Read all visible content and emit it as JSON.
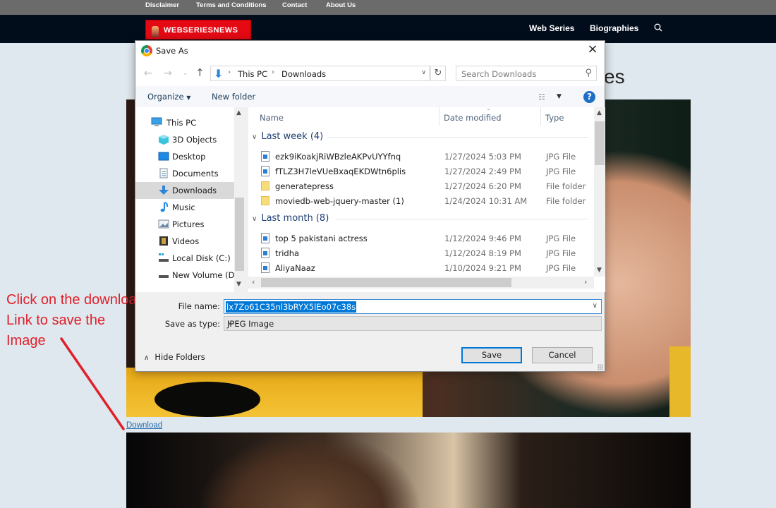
{
  "website": {
    "top_links": [
      "Disclaimer",
      "Terms and Conditions",
      "Contact",
      "About Us"
    ],
    "logo_text": "WEBSERIESNEWS",
    "nav_links": [
      "Web Series",
      "Biographies"
    ],
    "search_icon": "search-icon",
    "page_title_fragment": "es",
    "download_link": "Download",
    "colors": {
      "brand": "#e50914",
      "nav_bg": "#020d1c",
      "topbar_bg": "#6b6b6b",
      "page_bg": "#dfe8ee",
      "link": "#2c6fb0"
    }
  },
  "annotation": {
    "lines": [
      "Click on the download",
      "Link to save the",
      "Image"
    ],
    "color": "#e0202a"
  },
  "dialog": {
    "title": "Save As",
    "close_icon": "close-icon",
    "address": {
      "crumbs": [
        "This PC",
        "Downloads"
      ]
    },
    "search_placeholder": "Search Downloads",
    "toolbar": {
      "organize": "Organize",
      "new_folder": "New folder",
      "help": "?"
    },
    "nav_pane": [
      {
        "label": "This PC",
        "icon": "computer-icon"
      },
      {
        "label": "3D Objects",
        "icon": "cube-icon"
      },
      {
        "label": "Desktop",
        "icon": "desktop-icon"
      },
      {
        "label": "Documents",
        "icon": "document-icon"
      },
      {
        "label": "Downloads",
        "icon": "download-icon",
        "selected": true
      },
      {
        "label": "Music",
        "icon": "music-note-icon"
      },
      {
        "label": "Pictures",
        "icon": "picture-icon"
      },
      {
        "label": "Videos",
        "icon": "film-icon"
      },
      {
        "label": "Local Disk (C:)",
        "icon": "drive-icon"
      },
      {
        "label": "New Volume (D:)",
        "icon": "drive-icon"
      }
    ],
    "columns": [
      "Name",
      "Date modified",
      "Type"
    ],
    "groups": [
      {
        "label": "Last week (4)",
        "files": [
          {
            "name": "ezk9iKoakjRiWBzleAKPvUYYfnq",
            "date": "1/27/2024 5:03 PM",
            "type": "JPG File",
            "kind": "jpg"
          },
          {
            "name": "fTLZ3H7leVUeBxaqEKDWtn6plis",
            "date": "1/27/2024 2:49 PM",
            "type": "JPG File",
            "kind": "jpg"
          },
          {
            "name": "generatepress",
            "date": "1/27/2024 6:20 PM",
            "type": "File folder",
            "kind": "folder"
          },
          {
            "name": "moviedb-web-jquery-master (1)",
            "date": "1/24/2024 10:31 AM",
            "type": "File folder",
            "kind": "folder"
          }
        ]
      },
      {
        "label": "Last month (8)",
        "files": [
          {
            "name": "top 5 pakistani actress",
            "date": "1/12/2024 9:46 PM",
            "type": "JPG File",
            "kind": "jpg"
          },
          {
            "name": "tridha",
            "date": "1/12/2024 8:19 PM",
            "type": "JPG File",
            "kind": "jpg"
          },
          {
            "name": "AliyaNaaz",
            "date": "1/10/2024 9:21 PM",
            "type": "JPG File",
            "kind": "jpg"
          }
        ]
      }
    ],
    "file_name_label": "File name:",
    "file_name_value": "lx7Zo61C35nl3bRYX5lEo07c38s",
    "save_as_type_label": "Save as type:",
    "save_as_type_value": "JPEG Image",
    "hide_folders": "Hide Folders",
    "save_button": "Save",
    "cancel_button": "Cancel"
  }
}
